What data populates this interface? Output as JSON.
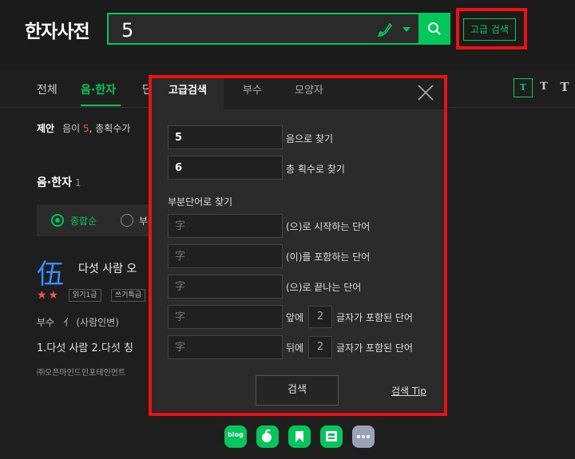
{
  "app": {
    "title": "한자사전"
  },
  "search": {
    "value": "5",
    "button_label": "검색"
  },
  "advanced_button": {
    "label": "고급 검색"
  },
  "tabs": [
    {
      "label": "전체"
    },
    {
      "label": "음·한자"
    },
    {
      "label": "단"
    }
  ],
  "font_buttons": [
    "T",
    "T",
    "T"
  ],
  "suggestion": {
    "prefix": "제안",
    "text_before": "음이 ",
    "highlight": "5",
    "text_after": ", 총획수가"
  },
  "section": {
    "title": "음·한자",
    "count": "1"
  },
  "filter": {
    "selected_label": "종합순",
    "other_label": "부"
  },
  "result": {
    "hanja": "伍",
    "meaning": "다섯 사람 오",
    "stars": "★★",
    "badges": [
      "읽기1급",
      "쓰기특급"
    ],
    "radical_label": "부수",
    "radical_value": "亻 (사람인변)",
    "definitions": "1.다섯 사람  2.다섯 칭",
    "copyright": "㈜오픈마인드인포테인먼트"
  },
  "panel": {
    "tabs": [
      {
        "label": "고급검색"
      },
      {
        "label": "부수"
      },
      {
        "label": "모양자"
      }
    ],
    "sound_field": {
      "value": "5",
      "label": "음으로 찾기"
    },
    "stroke_field": {
      "value": "6",
      "label": "총 획수로 찾기"
    },
    "partial_heading": "부분단어로 찾기",
    "placeholder": "字",
    "starts_label": "(으)로 시작하는 단어",
    "contains_label": "(이)를 포함하는 단어",
    "ends_label": "(으)로 끝나는 단어",
    "front_prefix": "앞에",
    "front_num": "2",
    "front_suffix": "글자가 포함된 단어",
    "back_prefix": "뒤에",
    "back_num": "2",
    "back_suffix": "글자가 포함된 단어",
    "search_label": "검색",
    "tip_label": "검색 Tip"
  },
  "dock": {
    "icons": [
      "blog-icon",
      "cafe-icon",
      "knowledge-icon",
      "news-icon",
      "more-icon"
    ],
    "blog_label": "blog"
  },
  "colors": {
    "accent": "#03c75a",
    "highlight_box": "#e11111",
    "background": "#1e1e1e"
  }
}
